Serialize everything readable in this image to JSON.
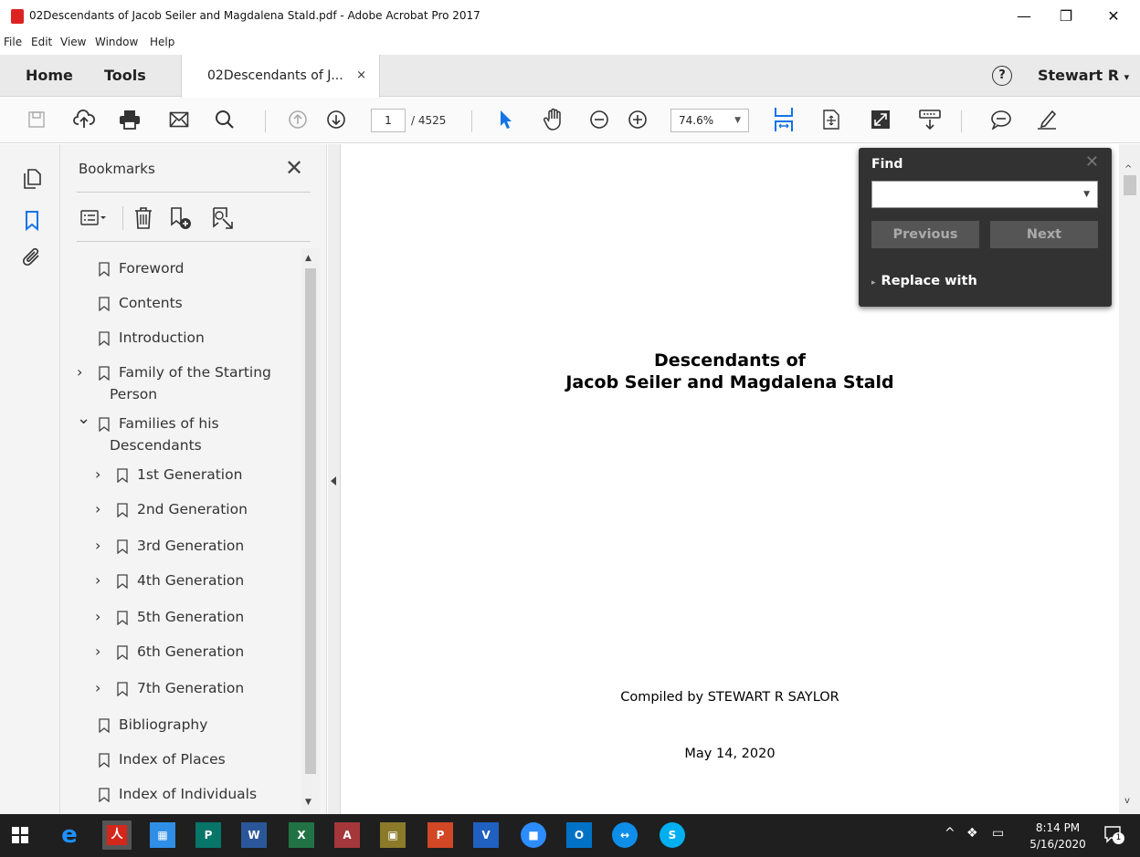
{
  "window": {
    "title": "02Descendants of Jacob Seiler and Magdalena Stald.pdf - Adobe Acrobat Pro 2017",
    "minimize": "—",
    "restore": "❐",
    "close": "✕"
  },
  "menu": [
    "File",
    "Edit",
    "View",
    "Window",
    "Help"
  ],
  "tabs": {
    "home": "Home",
    "tools": "Tools",
    "doc_tab": "02Descendants of J...",
    "doc_tab_close": "×",
    "help": "?",
    "user": "Stewart R",
    "user_caret": "▾"
  },
  "toolbar": {
    "page_current": "1",
    "page_total": "/ 4525",
    "zoom": "74.6%",
    "zoom_caret": "▼"
  },
  "bookmarks": {
    "title": "Bookmarks",
    "close": "✕",
    "items": [
      {
        "label": "Foreword"
      },
      {
        "label": "Contents"
      },
      {
        "label": "Introduction"
      },
      {
        "label": "Family of the Starting Person",
        "line1": "Family of the Starting",
        "line2": "Person",
        "chevron": "›"
      },
      {
        "label": "Families of his Descendants",
        "line1": "Families of his",
        "line2": "Descendants",
        "chevron": "⌄"
      },
      {
        "label": "1st Generation",
        "chevron": "›"
      },
      {
        "label": "2nd Generation",
        "chevron": "›"
      },
      {
        "label": "3rd Generation",
        "chevron": "›"
      },
      {
        "label": "4th Generation",
        "chevron": "›"
      },
      {
        "label": "5th Generation",
        "chevron": "›"
      },
      {
        "label": "6th Generation",
        "chevron": "›"
      },
      {
        "label": "7th Generation",
        "chevron": "›"
      },
      {
        "label": "Bibliography"
      },
      {
        "label": "Index of Places"
      },
      {
        "label": "Index of Individuals"
      }
    ]
  },
  "find": {
    "title": "Find",
    "close": "✕",
    "search_value": "",
    "previous": "Previous",
    "next": "Next",
    "replace_toggle": "▸",
    "replace_with": "Replace with",
    "dropdown": "▼"
  },
  "document": {
    "title_line1": "Descendants of",
    "title_line2": "Jacob Seiler and Magdalena Stald",
    "compiled_by": "Compiled by STEWART R SAYLOR",
    "date": "May 14, 2020"
  },
  "taskbar": {
    "time": "8:14 PM",
    "date": "5/16/2020",
    "notifications": "1"
  },
  "colors": {
    "acrobat_red": "#d4271c",
    "accent_blue": "#1473e6",
    "find_panel": "#323232",
    "taskbar": "#1f1f1f"
  }
}
